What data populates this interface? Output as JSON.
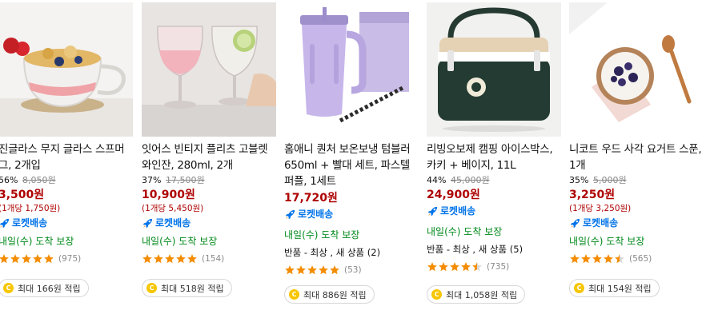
{
  "products": [
    {
      "title": "진글라스 무지 글라스 스프머그, 2개입",
      "discount_rate": "56%",
      "original_price": "8,050원",
      "price": "3,500원",
      "unit_price": "(1개당 1,750원)",
      "rocket_label": "로켓배송",
      "delivery": "내일(수) 도착 보장",
      "condition": "",
      "rating": 5,
      "review_count": "(975)",
      "cashback": "최대 166원 적립"
    },
    {
      "title": "잇어스 빈티지 플리츠 고블렛 와인잔, 280ml, 2개",
      "discount_rate": "37%",
      "original_price": "17,500원",
      "price": "10,900원",
      "unit_price": "(1개당 5,450원)",
      "rocket_label": "로켓배송",
      "delivery": "내일(수) 도착 보장",
      "condition": "",
      "rating": 5,
      "review_count": "(154)",
      "cashback": "최대 518원 적립"
    },
    {
      "title": "홈애니 퀀처 보온보냉 텀블러 650ml + 빨대 세트, 파스텔퍼플, 1세트",
      "discount_rate": "",
      "original_price": "",
      "price": "17,720원",
      "unit_price": "",
      "rocket_label": "로켓배송",
      "delivery": "내일(수) 도착 보장",
      "condition": "반품 - 최상 , 새 상품 (2)",
      "rating": 5,
      "review_count": "(53)",
      "cashback": "최대 886원 적립"
    },
    {
      "title": "리빙오보제 캠핑 아이스박스, 카키 + 베이지, 11L",
      "discount_rate": "44%",
      "original_price": "45,000원",
      "price": "24,900원",
      "unit_price": "",
      "rocket_label": "로켓배송",
      "delivery": "내일(수) 도착 보장",
      "condition": "반품 - 최상 , 새 상품 (5)",
      "rating": 4.5,
      "review_count": "(735)",
      "cashback": "최대 1,058원 적립"
    },
    {
      "title": "니코트 우드 사각 요거트 스푼, 1개",
      "discount_rate": "35%",
      "original_price": "5,000원",
      "price": "3,250원",
      "unit_price": "(1개당 3,250원)",
      "rocket_label": "로켓배송",
      "delivery": "내일(수) 도착 보장",
      "condition": "",
      "rating": 4.5,
      "review_count": "(565)",
      "cashback": "최대 154원 적립"
    }
  ],
  "icons": {
    "rocket": "rocket-delivery-icon",
    "coin": "coupang-cash-coin-icon",
    "star": "rating-star-icon"
  },
  "colors": {
    "price": "#ae0000",
    "rocket": "#0073e9",
    "delivery": "#00891a",
    "star": "#f48c00"
  }
}
